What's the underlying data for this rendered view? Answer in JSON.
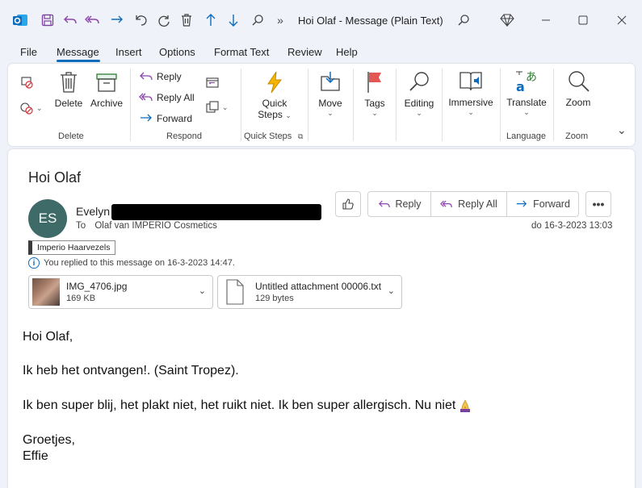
{
  "window": {
    "title": "Hoi Olaf  -  Message (Plain Text)"
  },
  "menu": [
    "File",
    "Message",
    "Insert",
    "Options",
    "Format Text",
    "Review",
    "Help"
  ],
  "ribbon": {
    "delete_label": "Delete",
    "archive_label": "Archive",
    "group_delete": "Delete",
    "reply_label": "Reply",
    "reply_all_label": "Reply All",
    "forward_label": "Forward",
    "group_respond": "Respond",
    "quick_steps_line1": "Quick",
    "quick_steps_line2": "Steps",
    "group_quick_steps": "Quick Steps",
    "move_label": "Move",
    "tags_label": "Tags",
    "editing_label": "Editing",
    "immersive_label": "Immersive",
    "translate_label": "Translate",
    "group_language": "Language",
    "zoom_label": "Zoom",
    "group_zoom": "Zoom"
  },
  "message": {
    "subject": "Hoi Olaf",
    "avatar_initials": "ES",
    "sender_name": "Evelyn",
    "to_label": "To",
    "to_value": "Olaf van IMPERIO Cosmetics",
    "date": "do 16-3-2023 13:03",
    "category": "Imperio Haarvezels",
    "info": "You replied to this message on 16-3-2023 14:47.",
    "actions": {
      "reply": "Reply",
      "reply_all": "Reply All",
      "forward": "Forward"
    },
    "attachments": [
      {
        "name": "IMG_4706.jpg",
        "size": "169 KB"
      },
      {
        "name": "Untitled attachment 00006.txt",
        "size": "129 bytes"
      }
    ],
    "body": {
      "greeting": "Hoi Olaf,",
      "line1": "Ik heb het ontvangen!. (Saint Tropez).",
      "line2": "Ik ben super blij, het plakt niet, het ruikt niet. Ik ben super allergisch. Nu niet",
      "closing1": "Groetjes,",
      "closing2": "Effie"
    }
  },
  "colors": {
    "accent": "#0f6cbd",
    "avatar": "#3e6b68",
    "reply_purple": "#8e44ad",
    "flag_red": "#e45555"
  }
}
